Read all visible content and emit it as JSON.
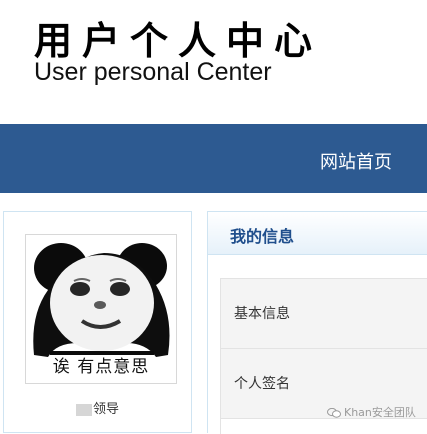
{
  "header": {
    "title_cn": "用户个人中心",
    "title_en": "User personal Center"
  },
  "nav": {
    "home": "网站首页"
  },
  "profile": {
    "avatar_caption": "诶 有点意思",
    "role": "领导"
  },
  "info_panel": {
    "title": "我的信息",
    "rows": [
      {
        "label": "基本信息"
      },
      {
        "label": "个人签名"
      }
    ]
  },
  "watermark": {
    "text": "Khan安全团队"
  },
  "colors": {
    "navbar": "#2d5a91",
    "panel_title": "#1f4e8c",
    "border": "#cfe4f2"
  },
  "icons": {
    "avatar": "panda-meme-face",
    "watermark": "wechat-icon"
  }
}
